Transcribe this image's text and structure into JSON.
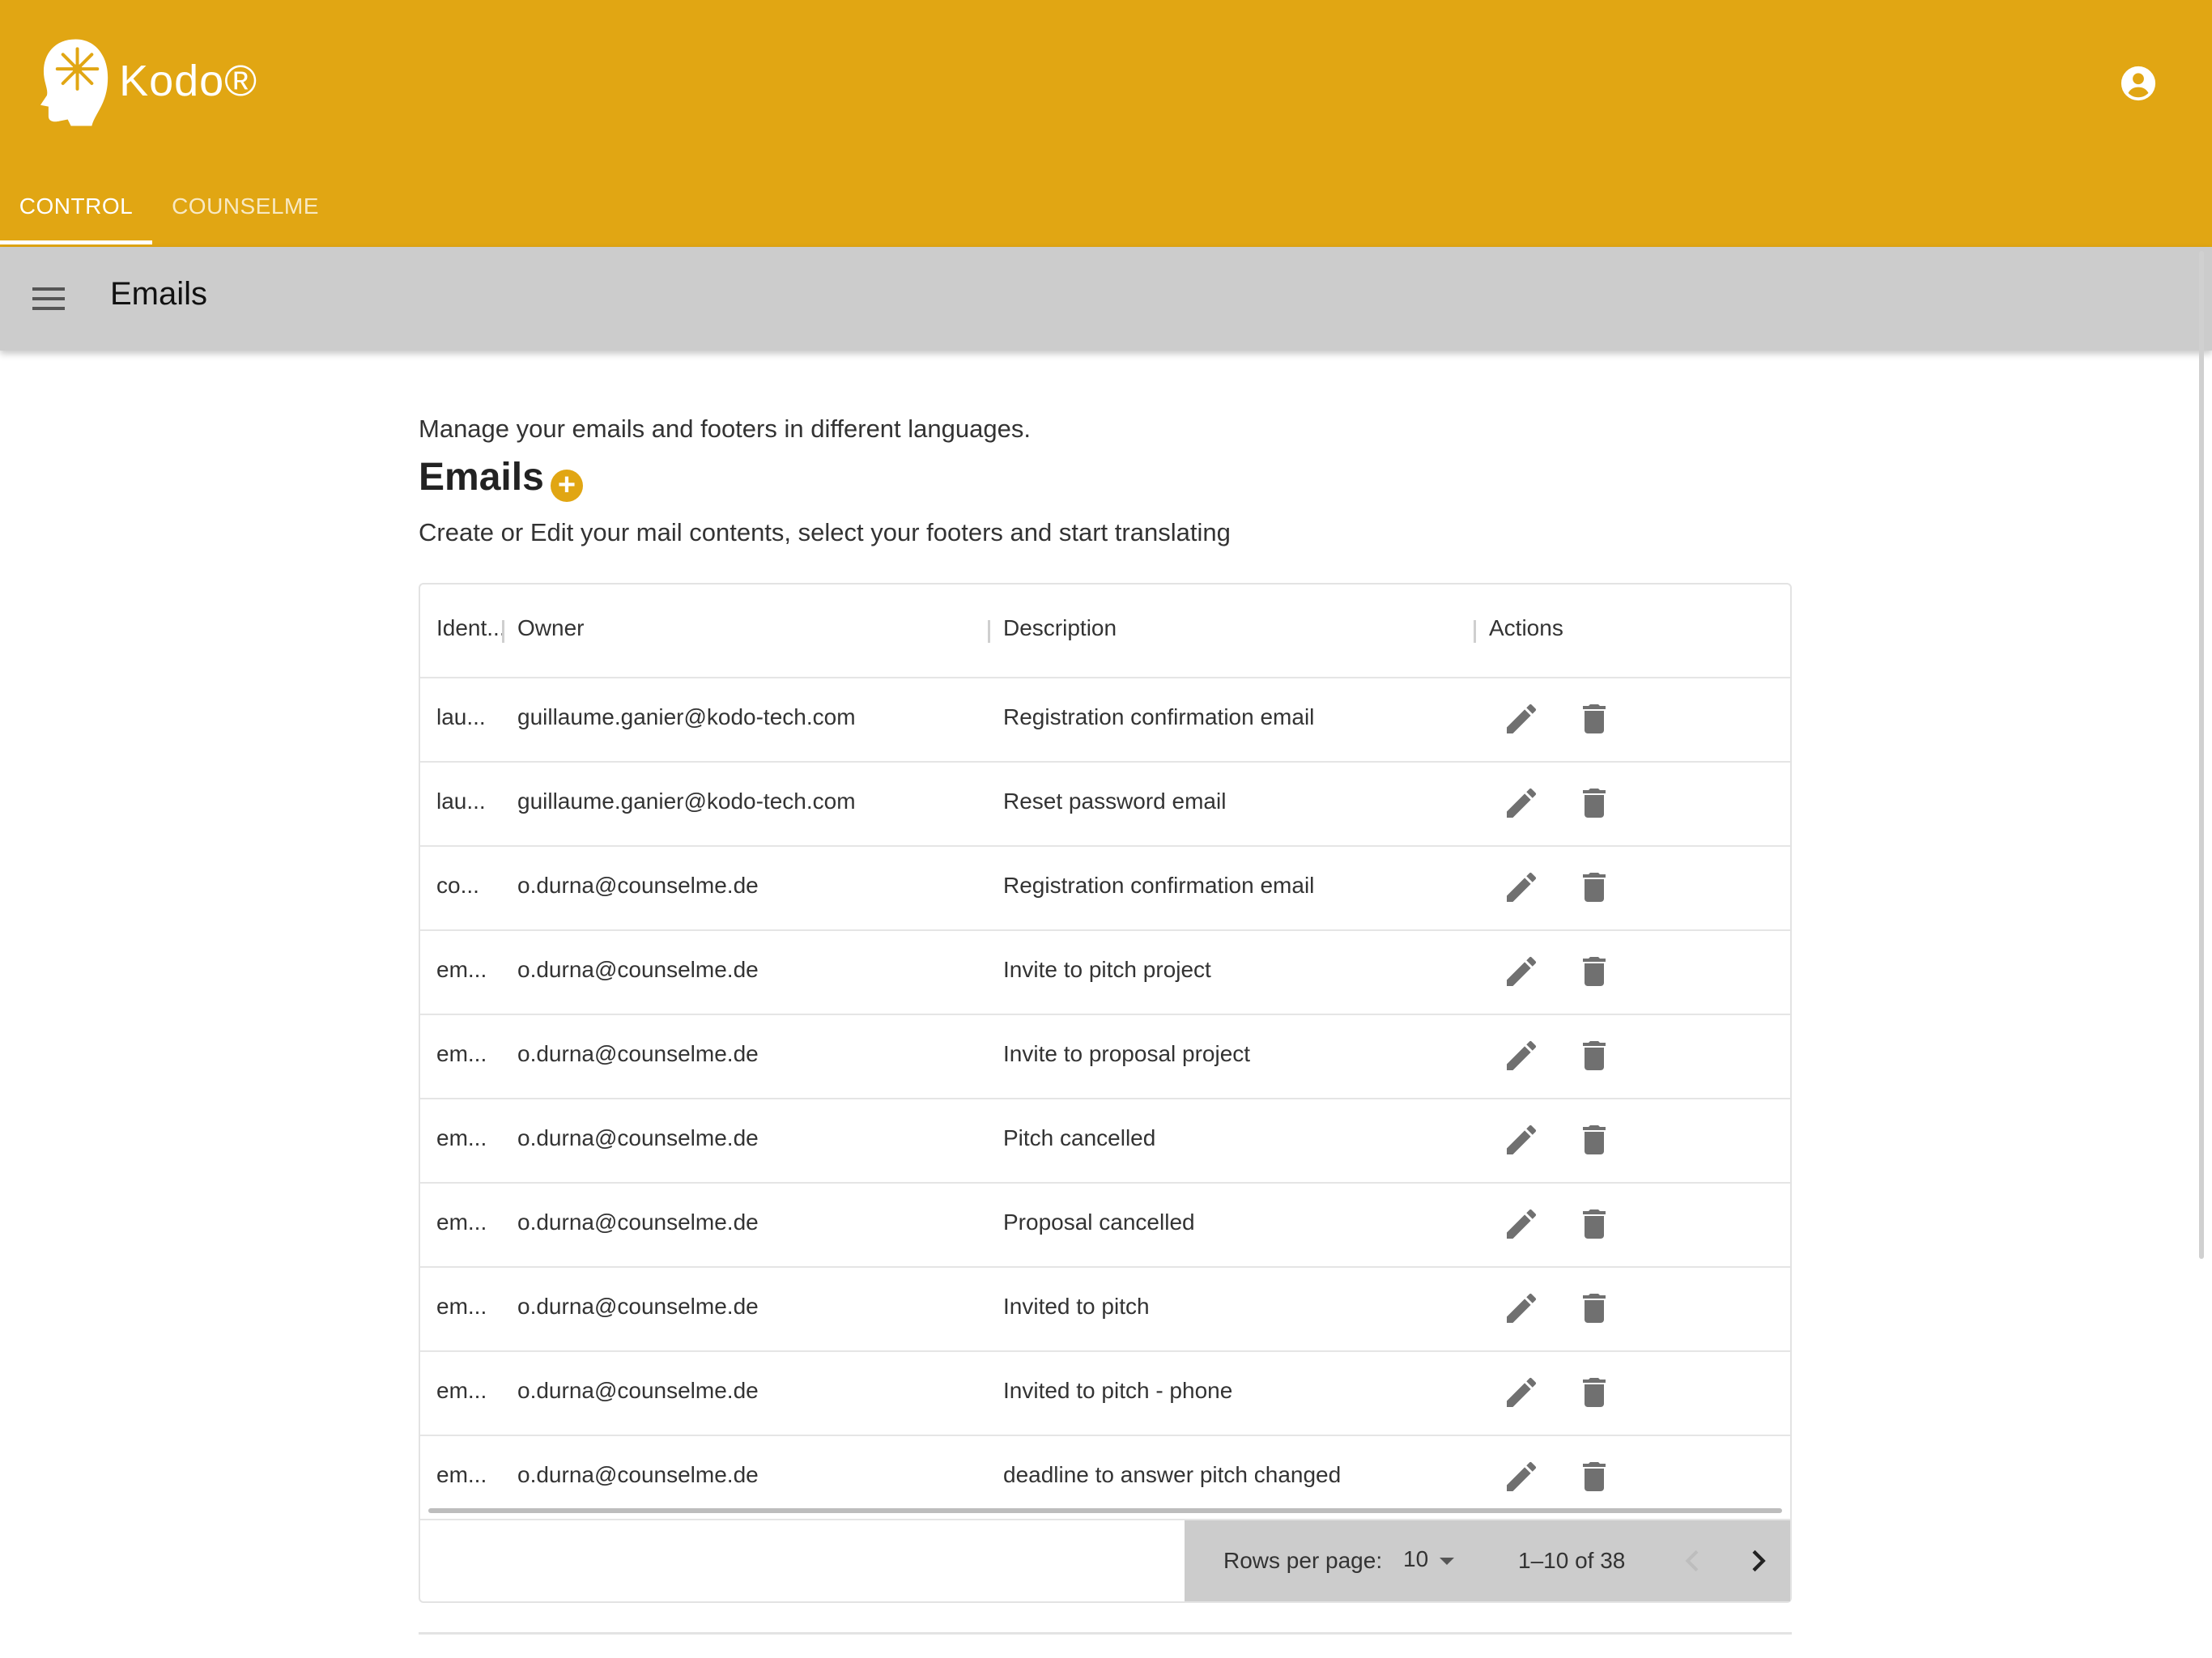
{
  "app": {
    "brand": "Kodo®",
    "colors": {
      "primary": "#e1a613",
      "toolbar": "#cccccc",
      "icon": "#707070"
    }
  },
  "tabs": [
    {
      "label": "CONTROL",
      "active": true
    },
    {
      "label": "COUNSELME",
      "active": false
    }
  ],
  "toolbar": {
    "title": "Emails"
  },
  "page": {
    "intro": "Manage your emails and footers in different languages.",
    "heading": "Emails",
    "subheading": "Create or Edit your mail contents, select your footers and start translating"
  },
  "table": {
    "columns": [
      "Ident...",
      "Owner",
      "Description",
      "Actions"
    ],
    "rows": [
      {
        "id": "lau...",
        "owner": "guillaume.ganier@kodo-tech.com",
        "description": "Registration confirmation email"
      },
      {
        "id": "lau...",
        "owner": "guillaume.ganier@kodo-tech.com",
        "description": "Reset password email"
      },
      {
        "id": "co...",
        "owner": "o.durna@counselme.de",
        "description": "Registration confirmation email"
      },
      {
        "id": "em...",
        "owner": "o.durna@counselme.de",
        "description": "Invite to pitch project"
      },
      {
        "id": "em...",
        "owner": "o.durna@counselme.de",
        "description": "Invite to proposal project"
      },
      {
        "id": "em...",
        "owner": "o.durna@counselme.de",
        "description": "Pitch cancelled"
      },
      {
        "id": "em...",
        "owner": "o.durna@counselme.de",
        "description": "Proposal cancelled"
      },
      {
        "id": "em...",
        "owner": "o.durna@counselme.de",
        "description": "Invited to pitch"
      },
      {
        "id": "em...",
        "owner": "o.durna@counselme.de",
        "description": "Invited to pitch - phone"
      },
      {
        "id": "em...",
        "owner": "o.durna@counselme.de",
        "description": "deadline to answer pitch changed"
      }
    ],
    "row_actions": [
      "pencil-icon",
      "trash-icon"
    ]
  },
  "pagination": {
    "rows_per_page_label": "Rows per page:",
    "rows_per_page": "10",
    "range": "1–10 of 38"
  }
}
